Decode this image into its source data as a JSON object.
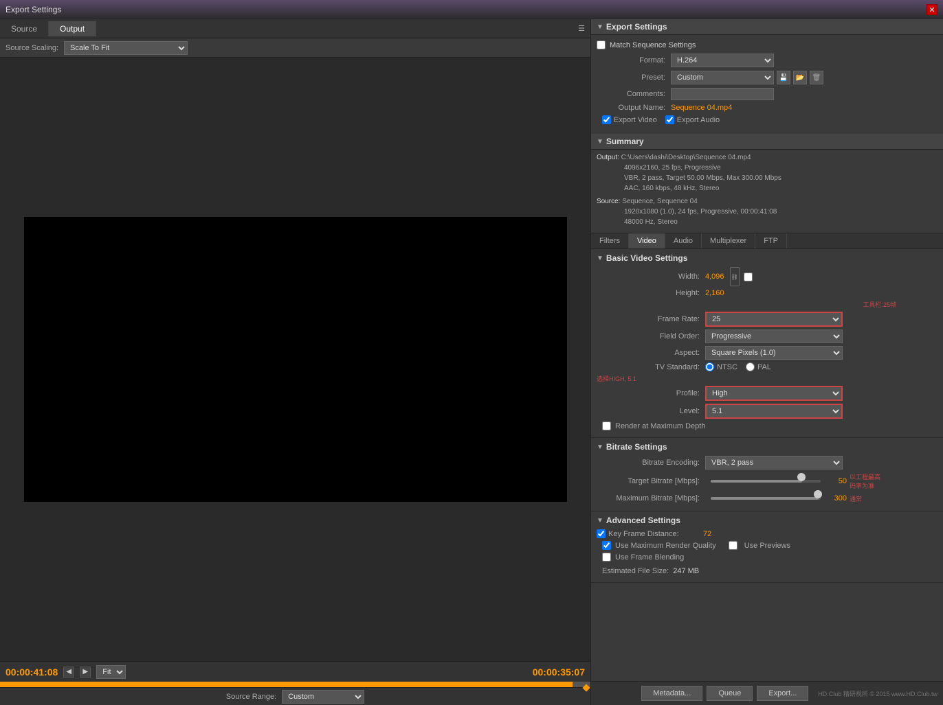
{
  "titleBar": {
    "title": "Export Settings"
  },
  "leftPanel": {
    "tabs": [
      {
        "label": "Source",
        "active": false
      },
      {
        "label": "Output",
        "active": true
      }
    ],
    "sourceScaling": {
      "label": "Source Scaling:",
      "value": "Scale To Fit"
    },
    "timecodeLeft": "00:00:41:08",
    "timecodeRight": "00:00:35:07",
    "fitLabel": "Fit",
    "sourceRange": {
      "label": "Source Range:",
      "value": "Custom"
    }
  },
  "rightPanel": {
    "exportSettings": {
      "title": "Export Settings",
      "matchSequence": {
        "label": "Match Sequence Settings"
      },
      "format": {
        "label": "Format:",
        "value": "H.264"
      },
      "preset": {
        "label": "Preset:",
        "value": "Custom"
      },
      "comments": {
        "label": "Comments:"
      },
      "outputName": {
        "label": "Output Name:",
        "value": "Sequence 04.mp4"
      },
      "exportVideo": {
        "label": "Export Video",
        "checked": true
      },
      "exportAudio": {
        "label": "Export Audio",
        "checked": true
      }
    },
    "summary": {
      "title": "Summary",
      "outputLabel": "Output:",
      "outputLine1": "C:\\Users\\dashi\\Desktop\\Sequence 04.mp4",
      "outputLine2": "4096x2160, 25 fps, Progressive",
      "outputLine3": "VBR, 2 pass, Target 50.00 Mbps, Max 300.00 Mbps",
      "outputLine4": "AAC, 160 kbps, 48 kHz, Stereo",
      "sourceLabel": "Source:",
      "sourceLine1": "Sequence, Sequence 04",
      "sourceLine2": "1920x1080 (1.0), 24 fps, Progressive, 00:00:41:08",
      "sourceLine3": "48000 Hz, Stereo"
    },
    "vtabs": [
      {
        "label": "Filters",
        "active": false
      },
      {
        "label": "Video",
        "active": true
      },
      {
        "label": "Audio",
        "active": false
      },
      {
        "label": "Multiplexer",
        "active": false
      },
      {
        "label": "FTP",
        "active": false
      }
    ],
    "basicVideoSettings": {
      "title": "Basic Video Settings",
      "width": {
        "label": "Width:",
        "value": "4,096"
      },
      "height": {
        "label": "Height:",
        "value": "2,160"
      },
      "frameRate": {
        "label": "Frame Rate:",
        "value": "25"
      },
      "fieldOrder": {
        "label": "Field Order:",
        "value": "Progressive"
      },
      "aspect": {
        "label": "Aspect:",
        "value": "Square Pixels (1.0)"
      },
      "tvStandard": {
        "label": "TV Standard:",
        "ntsc": "NTSC",
        "pal": "PAL"
      },
      "profile": {
        "label": "Profile:",
        "value": "High"
      },
      "level": {
        "label": "Level:",
        "value": "5.1"
      },
      "renderAtMaxDepth": {
        "label": "Render at Maximum Depth"
      }
    },
    "bitrateSettings": {
      "title": "Bitrate Settings",
      "encoding": {
        "label": "Bitrate Encoding:",
        "value": "VBR, 2 pass"
      },
      "targetBitrate": {
        "label": "Target Bitrate [Mbps]:",
        "value": "50",
        "percent": 83
      },
      "maxBitrate": {
        "label": "Maximum Bitrate [Mbps]:",
        "value": "300",
        "percent": 98
      }
    },
    "advancedSettings": {
      "title": "Advanced Settings",
      "keyFrameDistance": {
        "label": "Key Frame Distance:",
        "value": "72",
        "checked": true
      },
      "useMaxRenderQuality": {
        "label": "Use Maximum Render Quality",
        "checked": true
      },
      "usePreviews": {
        "label": "Use Previews",
        "checked": false
      },
      "useFrameBlending": {
        "label": "Use Frame Blending",
        "checked": false
      },
      "estimatedFileSize": {
        "label": "Estimated File Size:",
        "value": "247 MB"
      }
    },
    "bottomButtons": {
      "metadata": "Metadata...",
      "queue": "Queue",
      "export": "Export..."
    }
  }
}
